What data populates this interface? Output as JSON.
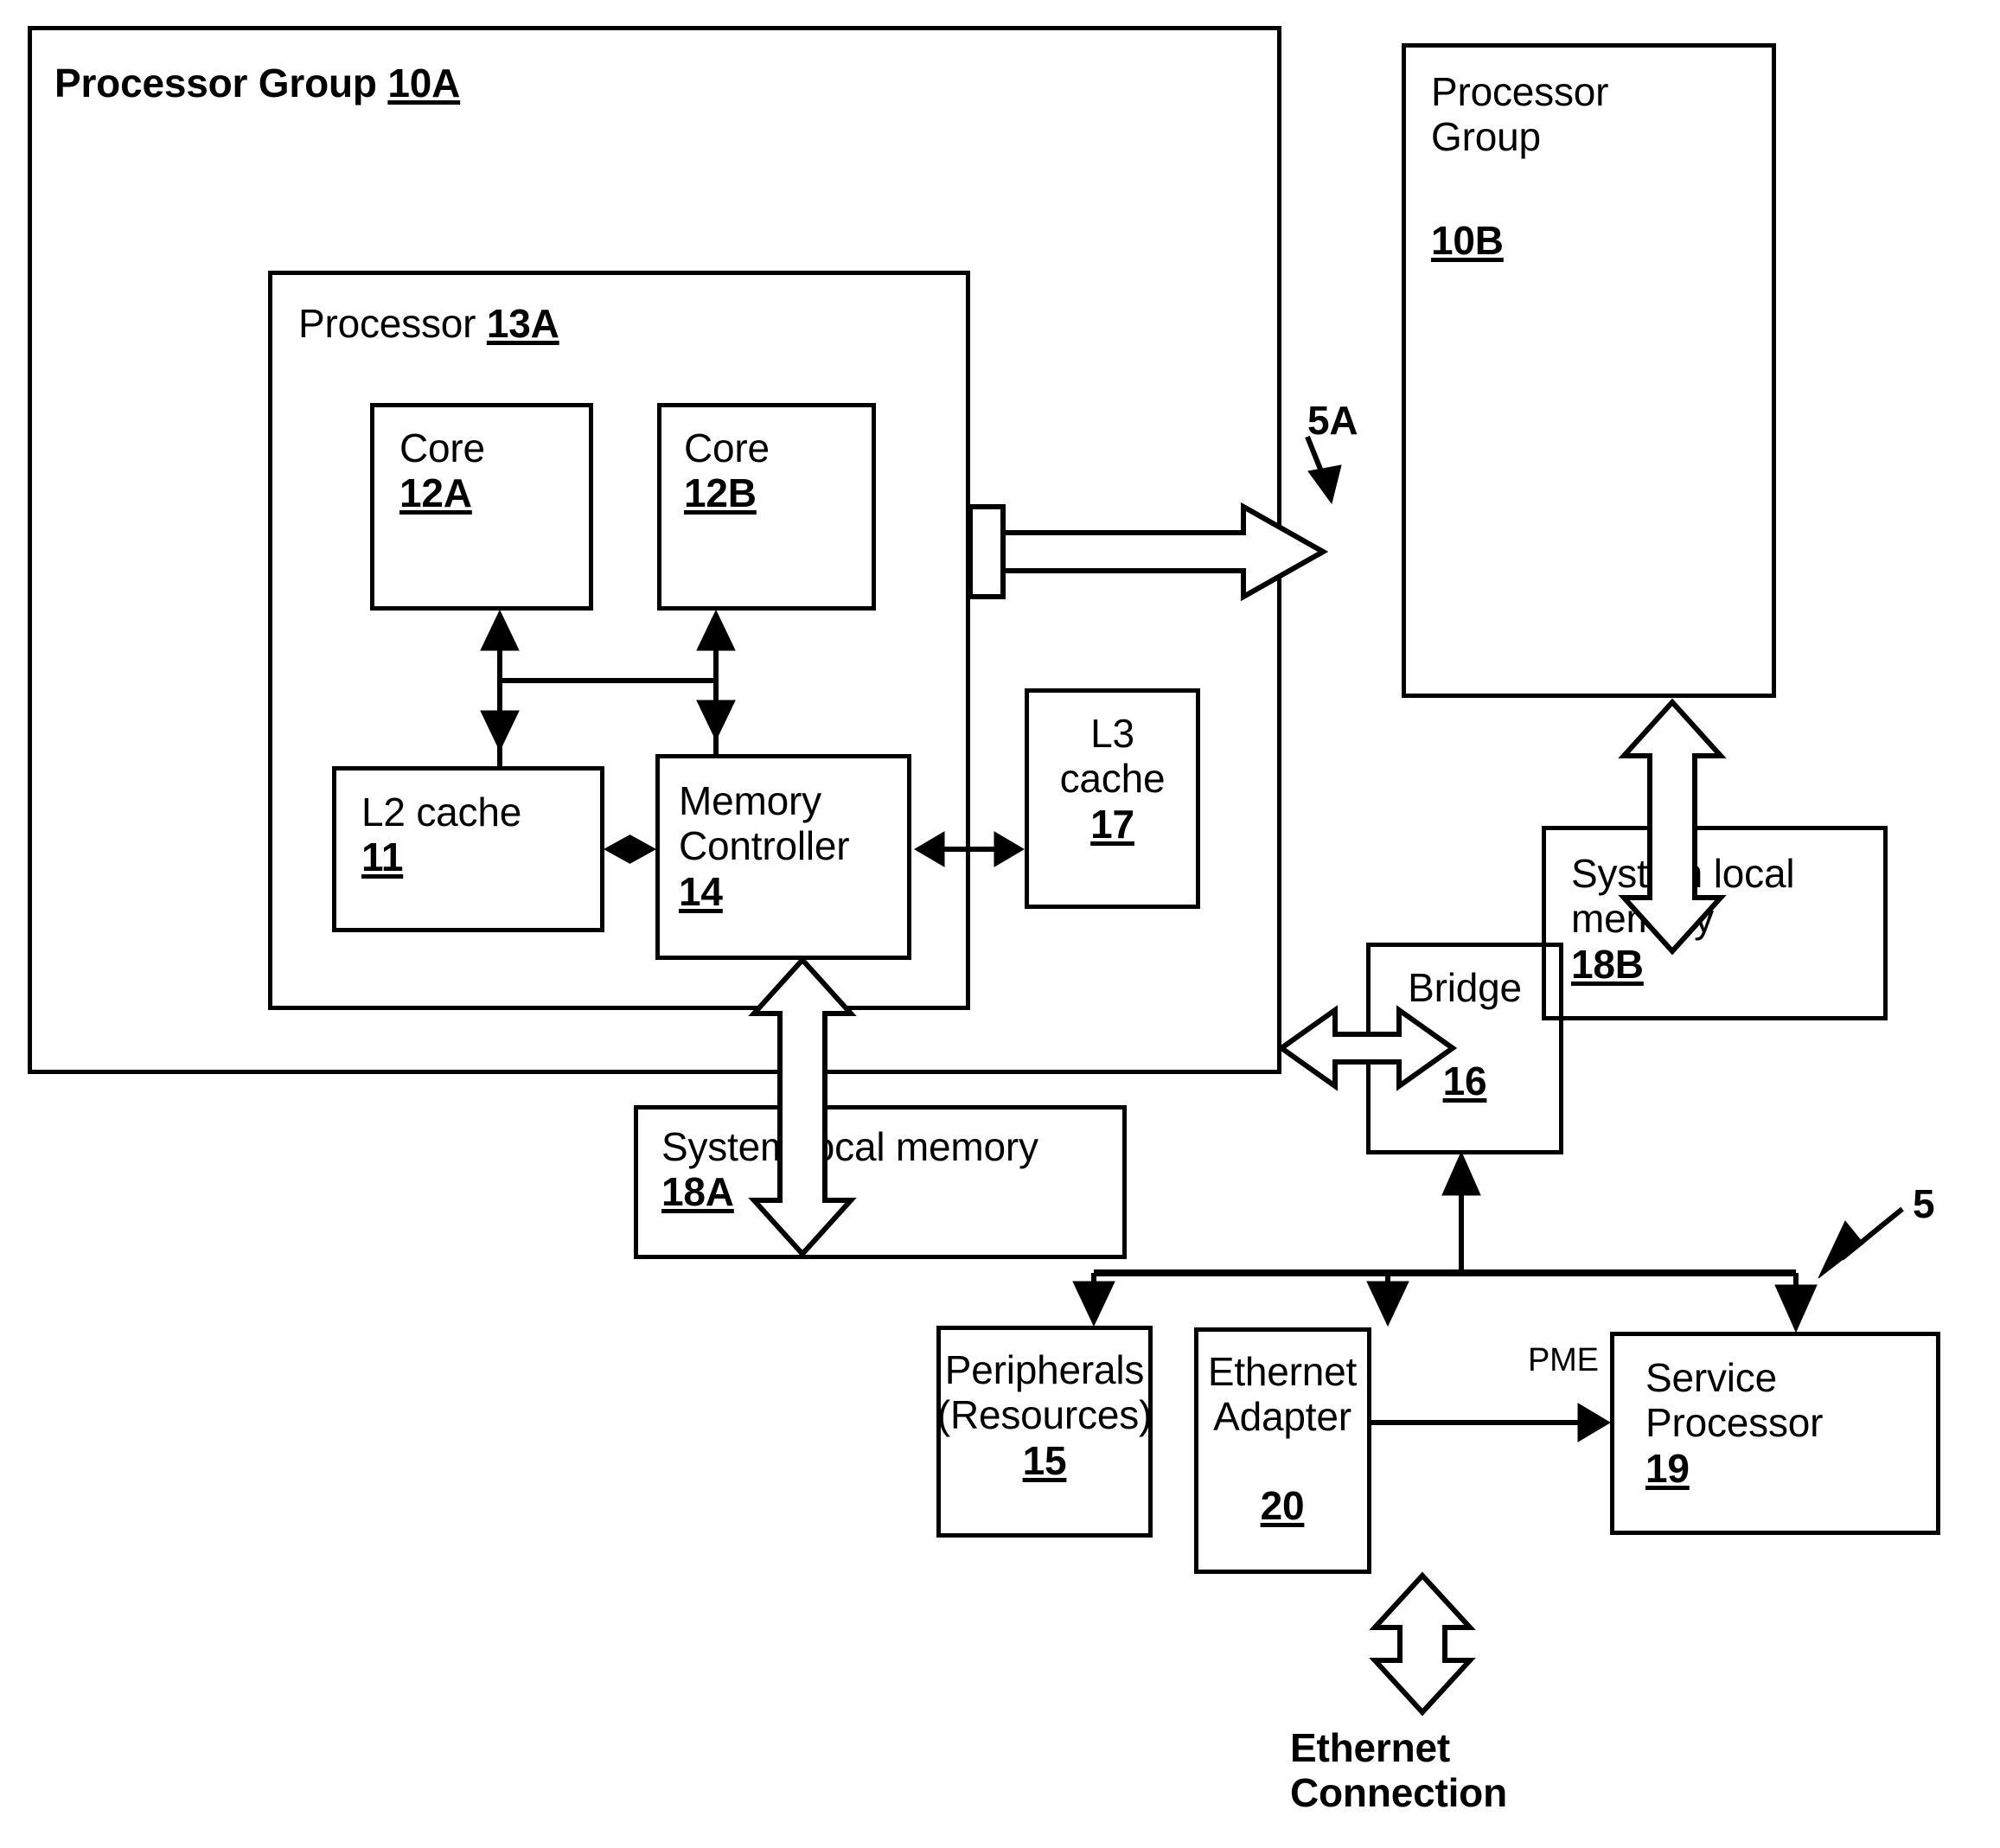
{
  "figure": {
    "type": "patent-block-diagram",
    "background": "#ffffff",
    "stroke": "#000000"
  },
  "blocks": {
    "processor_group_a": {
      "title": "Processor Group ",
      "ref": "10A"
    },
    "processor_a": {
      "title": "Processor ",
      "ref": "13A"
    },
    "core_a": {
      "title": "Core",
      "ref": "12A"
    },
    "core_b": {
      "title": "Core",
      "ref": "12B"
    },
    "l2_cache": {
      "title": "L2 cache",
      "ref": "11"
    },
    "memory_controller": {
      "title": "Memory\nController",
      "ref": "14"
    },
    "l3_cache": {
      "title": "L3\ncache",
      "ref": "17"
    },
    "processor_group_b": {
      "title": "Processor\nGroup",
      "ref": "10B"
    },
    "system_local_memory_b": {
      "title": "System local\nmemory",
      "ref": "18B"
    },
    "system_local_memory_a": {
      "title": "System local memory",
      "ref": "18A"
    },
    "bridge": {
      "title": "Bridge",
      "ref": "16"
    },
    "peripherals": {
      "title": "Peripherals\n(Resources)",
      "ref": "15"
    },
    "ethernet_adapter": {
      "title": "Ethernet\nAdapter",
      "ref": "20"
    },
    "service_processor": {
      "title": "Service\nProcessor",
      "ref": "19"
    }
  },
  "annotations": {
    "interconnect_5a": "5A",
    "bus_5": "5",
    "pme_signal": "PME",
    "ethernet_connection": "Ethernet\nConnection"
  }
}
